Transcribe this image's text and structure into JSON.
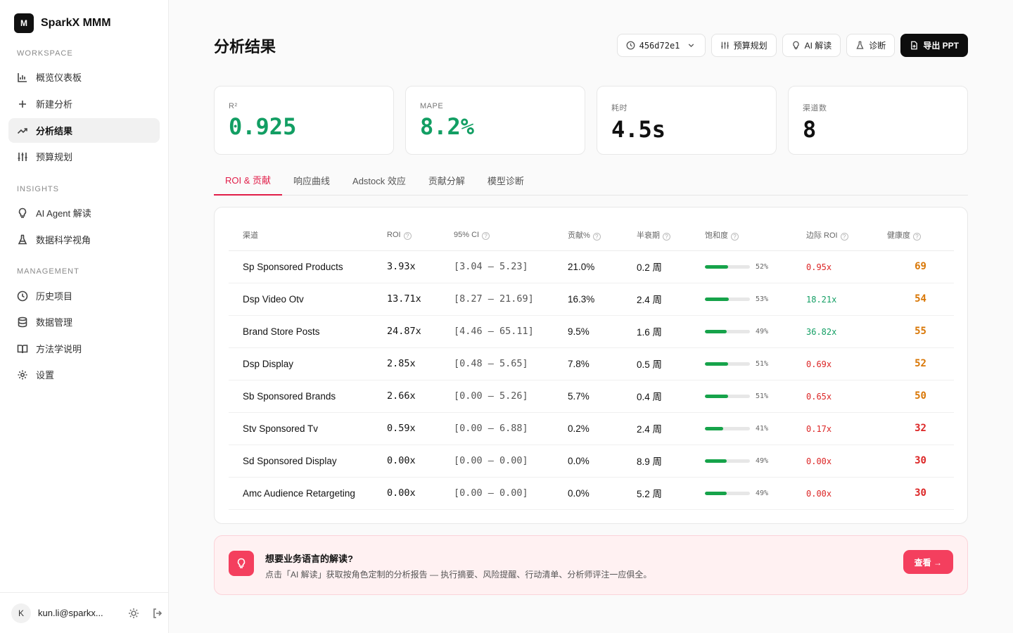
{
  "brand": {
    "logo_letter": "M",
    "name": "SparkX MMM"
  },
  "sidebar": {
    "sections": [
      {
        "title": "WORKSPACE",
        "items": [
          {
            "label": "概览仪表板",
            "icon": "bar-chart-icon"
          },
          {
            "label": "新建分析",
            "icon": "plus-icon"
          },
          {
            "label": "分析结果",
            "icon": "trending-up-icon",
            "active": true
          },
          {
            "label": "预算规划",
            "icon": "sliders-icon"
          }
        ]
      },
      {
        "title": "INSIGHTS",
        "items": [
          {
            "label": "AI Agent 解读",
            "icon": "lightbulb-icon"
          },
          {
            "label": "数据科学视角",
            "icon": "flask-icon"
          }
        ]
      },
      {
        "title": "MANAGEMENT",
        "items": [
          {
            "label": "历史项目",
            "icon": "clock-icon"
          },
          {
            "label": "数据管理",
            "icon": "database-icon"
          },
          {
            "label": "方法学说明",
            "icon": "book-icon"
          },
          {
            "label": "设置",
            "icon": "gear-icon"
          }
        ]
      }
    ],
    "user": {
      "initial": "K",
      "email": "kun.li@sparkx..."
    }
  },
  "header": {
    "title": "分析结果",
    "version": "456d72e1",
    "buttons": {
      "budget": "预算规划",
      "ai": "AI 解读",
      "diagnose": "诊断",
      "export": "导出 PPT"
    }
  },
  "metrics": [
    {
      "label": "R²",
      "value": "0.925"
    },
    {
      "label": "MAPE",
      "value": "8.2%"
    },
    {
      "label": "耗时",
      "value": "4.5s"
    },
    {
      "label": "渠道数",
      "value": "8"
    }
  ],
  "tabs": [
    "ROI & 贡献",
    "响应曲线",
    "Adstock 效应",
    "贡献分解",
    "模型诊断"
  ],
  "table": {
    "headers": [
      "渠道",
      "ROI",
      "95% CI",
      "贡献%",
      "半衰期",
      "饱和度",
      "边际 ROI",
      "健康度"
    ],
    "rows": [
      {
        "channel": "Sp Sponsored Products",
        "roi": "3.93x",
        "ci": "[3.04 – 5.23]",
        "contrib": "21.0%",
        "half_life": "0.2 周",
        "saturation": 52,
        "saturation_label": "52%",
        "mroi": "0.95x",
        "mroi_status": "low",
        "health": "69",
        "health_status": "warn"
      },
      {
        "channel": "Dsp Video Otv",
        "roi": "13.71x",
        "ci": "[8.27 – 21.69]",
        "contrib": "16.3%",
        "half_life": "2.4 周",
        "saturation": 53,
        "saturation_label": "53%",
        "mroi": "18.21x",
        "mroi_status": "high",
        "health": "54",
        "health_status": "warn"
      },
      {
        "channel": "Brand Store Posts",
        "roi": "24.87x",
        "ci": "[4.46 – 65.11]",
        "contrib": "9.5%",
        "half_life": "1.6 周",
        "saturation": 49,
        "saturation_label": "49%",
        "mroi": "36.82x",
        "mroi_status": "high",
        "health": "55",
        "health_status": "warn"
      },
      {
        "channel": "Dsp Display",
        "roi": "2.85x",
        "ci": "[0.48 – 5.65]",
        "contrib": "7.8%",
        "half_life": "0.5 周",
        "saturation": 51,
        "saturation_label": "51%",
        "mroi": "0.69x",
        "mroi_status": "low",
        "health": "52",
        "health_status": "warn"
      },
      {
        "channel": "Sb Sponsored Brands",
        "roi": "2.66x",
        "ci": "[0.00 – 5.26]",
        "contrib": "5.7%",
        "half_life": "0.4 周",
        "saturation": 51,
        "saturation_label": "51%",
        "mroi": "0.65x",
        "mroi_status": "low",
        "health": "50",
        "health_status": "warn"
      },
      {
        "channel": "Stv Sponsored Tv",
        "roi": "0.59x",
        "ci": "[0.00 – 6.88]",
        "contrib": "0.2%",
        "half_life": "2.4 周",
        "saturation": 41,
        "saturation_label": "41%",
        "mroi": "0.17x",
        "mroi_status": "low",
        "health": "32",
        "health_status": "bad"
      },
      {
        "channel": "Sd Sponsored Display",
        "roi": "0.00x",
        "ci": "[0.00 – 0.00]",
        "contrib": "0.0%",
        "half_life": "8.9 周",
        "saturation": 49,
        "saturation_label": "49%",
        "mroi": "0.00x",
        "mroi_status": "low",
        "health": "30",
        "health_status": "bad"
      },
      {
        "channel": "Amc Audience Retargeting",
        "roi": "0.00x",
        "ci": "[0.00 – 0.00]",
        "contrib": "0.0%",
        "half_life": "5.2 周",
        "saturation": 49,
        "saturation_label": "49%",
        "mroi": "0.00x",
        "mroi_status": "low",
        "health": "30",
        "health_status": "bad"
      }
    ]
  },
  "banner": {
    "title": "想要业务语言的解读?",
    "text": "点击「AI 解读」获取按角色定制的分析报告 — 执行摘要、风险提醒、行动清单、分析师评注一应俱全。",
    "button": "查看 →"
  },
  "colors": {
    "accent": "#e11d48",
    "good": "#129e63",
    "bad": "#dc2626",
    "warn": "#d97706",
    "primary": "#0d0d0d"
  }
}
